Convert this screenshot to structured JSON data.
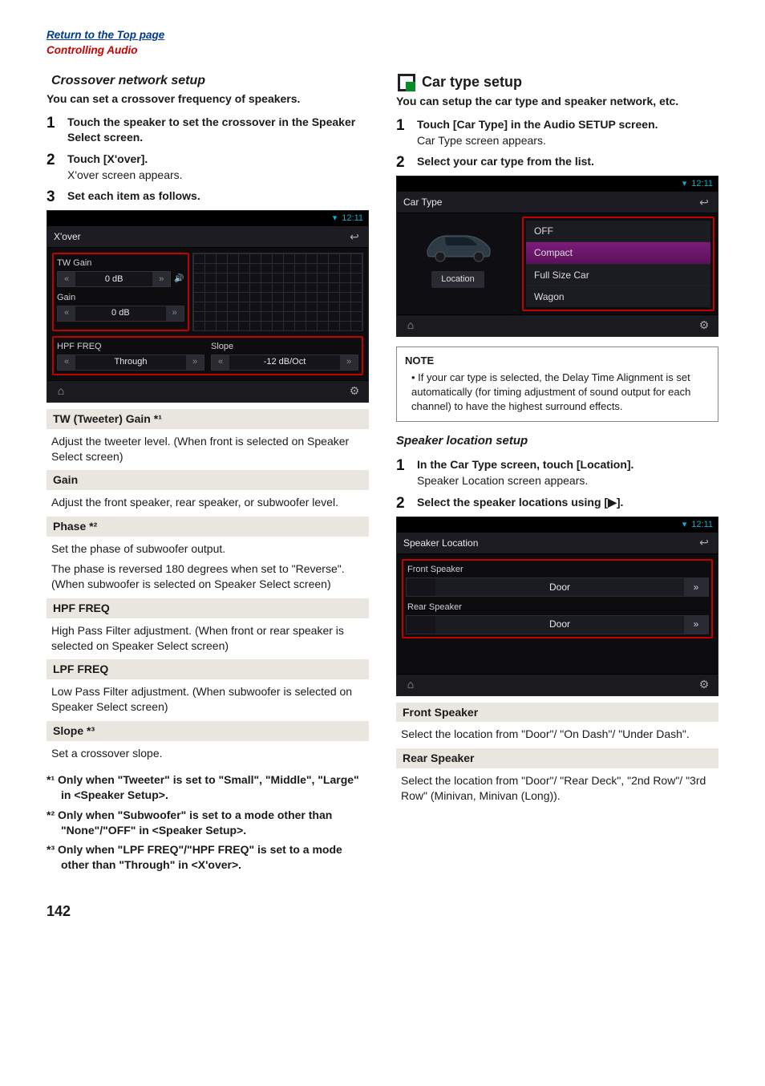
{
  "links": {
    "top": "Return to the Top page",
    "crumb": "Controlling Audio"
  },
  "left": {
    "heading": "Crossover network setup",
    "lead": "You can set a crossover frequency of speakers.",
    "steps": [
      {
        "n": "1",
        "title": "Touch the speaker to set the crossover in the Speaker Select screen."
      },
      {
        "n": "2",
        "title": "Touch [X'over].",
        "sub": "X'over screen appears."
      },
      {
        "n": "3",
        "title": "Set each item as follows."
      }
    ],
    "shot_xover": {
      "time": "12:11",
      "title": "X'over",
      "tw_gain_label": "TW Gain",
      "tw_gain_value": "0 dB",
      "gain_label": "Gain",
      "gain_value": "0 dB",
      "hpf_label": "HPF FREQ",
      "hpf_value": "Through",
      "slope_label": "Slope",
      "slope_value": "-12 dB/Oct"
    },
    "defs": [
      {
        "term": "TW (Tweeter) Gain *¹",
        "body": "Adjust the tweeter level. (When front is selected on Speaker Select screen)"
      },
      {
        "term": "Gain",
        "body": "Adjust the front speaker, rear speaker, or subwoofer level."
      },
      {
        "term": "Phase *²",
        "body": "Set the phase of subwoofer output.",
        "body2": "The phase is reversed 180 degrees when set to \"Reverse\". (When subwoofer is selected on Speaker Select screen)"
      },
      {
        "term": "HPF FREQ",
        "body": "High Pass Filter adjustment. (When front or rear speaker is selected on Speaker Select screen)"
      },
      {
        "term": "LPF FREQ",
        "body": "Low Pass Filter adjustment. (When subwoofer is selected on Speaker Select screen)"
      },
      {
        "term": "Slope *³",
        "body": "Set a crossover slope."
      }
    ],
    "footnotes": [
      "*¹ Only when \"Tweeter\" is set to \"Small\", \"Middle\", \"Large\" in <Speaker Setup>.",
      "*² Only when \"Subwoofer\" is set to a mode other than \"None\"/\"OFF\" in <Speaker Setup>.",
      "*³ Only when \"LPF FREQ\"/\"HPF FREQ\" is set to a mode other than \"Through\" in <X'over>."
    ]
  },
  "right": {
    "heading": "Car type setup",
    "lead": "You can setup the car type and speaker network, etc.",
    "steps_car": [
      {
        "n": "1",
        "title": "Touch [Car Type] in the Audio SETUP screen.",
        "sub": "Car Type screen appears."
      },
      {
        "n": "2",
        "title": "Select your car type from the list."
      }
    ],
    "shot_car": {
      "time": "12:11",
      "title": "Car Type",
      "location_btn": "Location",
      "options": [
        "OFF",
        "Compact",
        "Full Size Car",
        "Wagon"
      ],
      "selected_index": 1
    },
    "note_title": "NOTE",
    "note_body": "If your car type is selected, the Delay Time Alignment is set automatically (for timing adjustment of sound output for each channel) to have the highest surround effects.",
    "heading2": "Speaker location setup",
    "steps_spk": [
      {
        "n": "1",
        "title": "In the Car Type screen, touch [Location].",
        "sub": "Speaker Location screen appears."
      },
      {
        "n": "2",
        "title": "Select the speaker locations using [▶]."
      }
    ],
    "shot_spk": {
      "time": "12:11",
      "title": "Speaker Location",
      "front_label": "Front Speaker",
      "front_value": "Door",
      "rear_label": "Rear Speaker",
      "rear_value": "Door"
    },
    "defs": [
      {
        "term": "Front Speaker",
        "body": "Select the location from \"Door\"/ \"On Dash\"/ \"Under Dash\"."
      },
      {
        "term": "Rear Speaker",
        "body": "Select the location from \"Door\"/ \"Rear Deck\", \"2nd Row\"/ \"3rd Row\" (Minivan, Minivan (Long))."
      }
    ]
  },
  "page_number": "142"
}
